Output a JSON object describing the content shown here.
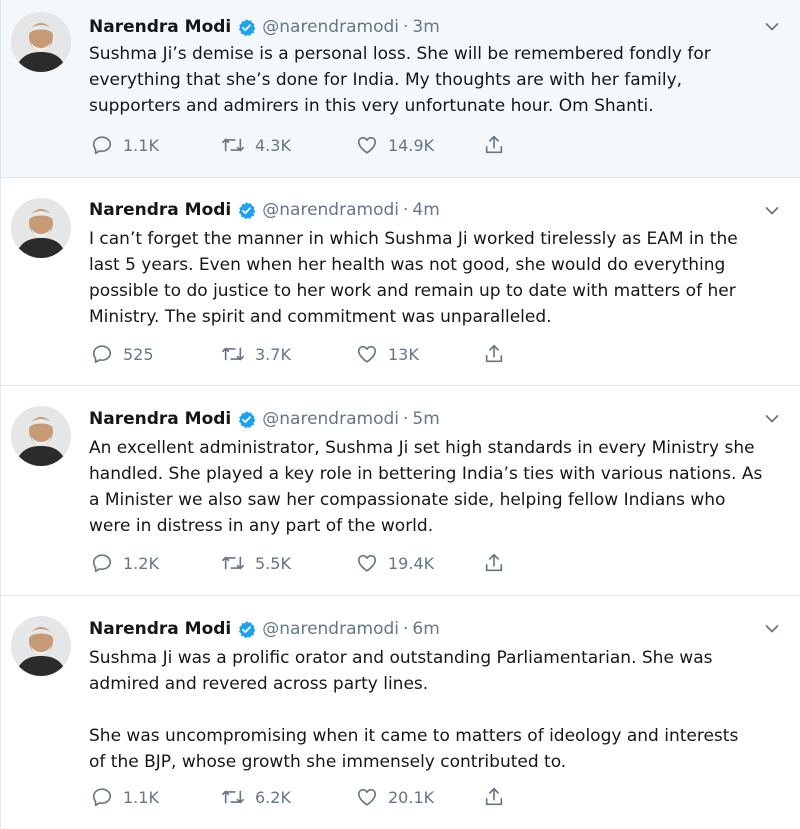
{
  "tweets": [
    {
      "name": "Narendra Modi",
      "handle": "@narendramodi",
      "separator": "·",
      "time": "3m",
      "lines": [
        "Sushma Ji’s demise is a personal loss. She will be remembered fondly for",
        "everything that she’s done for India. My thoughts are with her family,",
        "supporters and admirers in this very unfortunate hour. Om Shanti."
      ],
      "replies": "1.1K",
      "retweets": "4.3K",
      "likes": "14.9K"
    },
    {
      "name": "Narendra Modi",
      "handle": "@narendramodi",
      "separator": "·",
      "time": "4m",
      "lines": [
        "I can’t forget the manner in which Sushma Ji worked tirelessly as EAM in the",
        "last 5 years. Even when her health was not good, she would do everything",
        "possible to do justice to her work and remain up to date with matters of her",
        "Ministry. The spirit and commitment was unparalleled."
      ],
      "replies": "525",
      "retweets": "3.7K",
      "likes": "13K"
    },
    {
      "name": "Narendra Modi",
      "handle": "@narendramodi",
      "separator": "·",
      "time": "5m",
      "lines": [
        "An excellent administrator, Sushma Ji set high standards in every Ministry she",
        "handled. She played a key role in bettering India’s ties with various nations. As",
        "a Minister we also saw her compassionate side, helping fellow Indians who",
        "were in distress in any part of the world."
      ],
      "replies": "1.2K",
      "retweets": "5.5K",
      "likes": "19.4K"
    },
    {
      "name": "Narendra Modi",
      "handle": "@narendramodi",
      "separator": "·",
      "time": "6m",
      "lines": [
        "Sushma Ji was a prolific orator and outstanding Parliamentarian. She was",
        "admired and revered across party lines."
      ],
      "lines2": [
        "She was uncompromising when it came to matters of ideology and interests",
        "of the BJP, whose growth she immensely contributed to."
      ],
      "replies": "1.1K",
      "retweets": "6.2K",
      "likes": "20.1K"
    }
  ],
  "icons": {
    "reply": "reply-icon",
    "retweet": "retweet-icon",
    "like": "like-icon",
    "share": "share-icon",
    "verified": "verified-badge-icon",
    "caret": "chevron-down-icon"
  },
  "colors": {
    "verified": "#1da1f2",
    "muted": "#657786",
    "highlight_bg": "#f5f8fa"
  }
}
